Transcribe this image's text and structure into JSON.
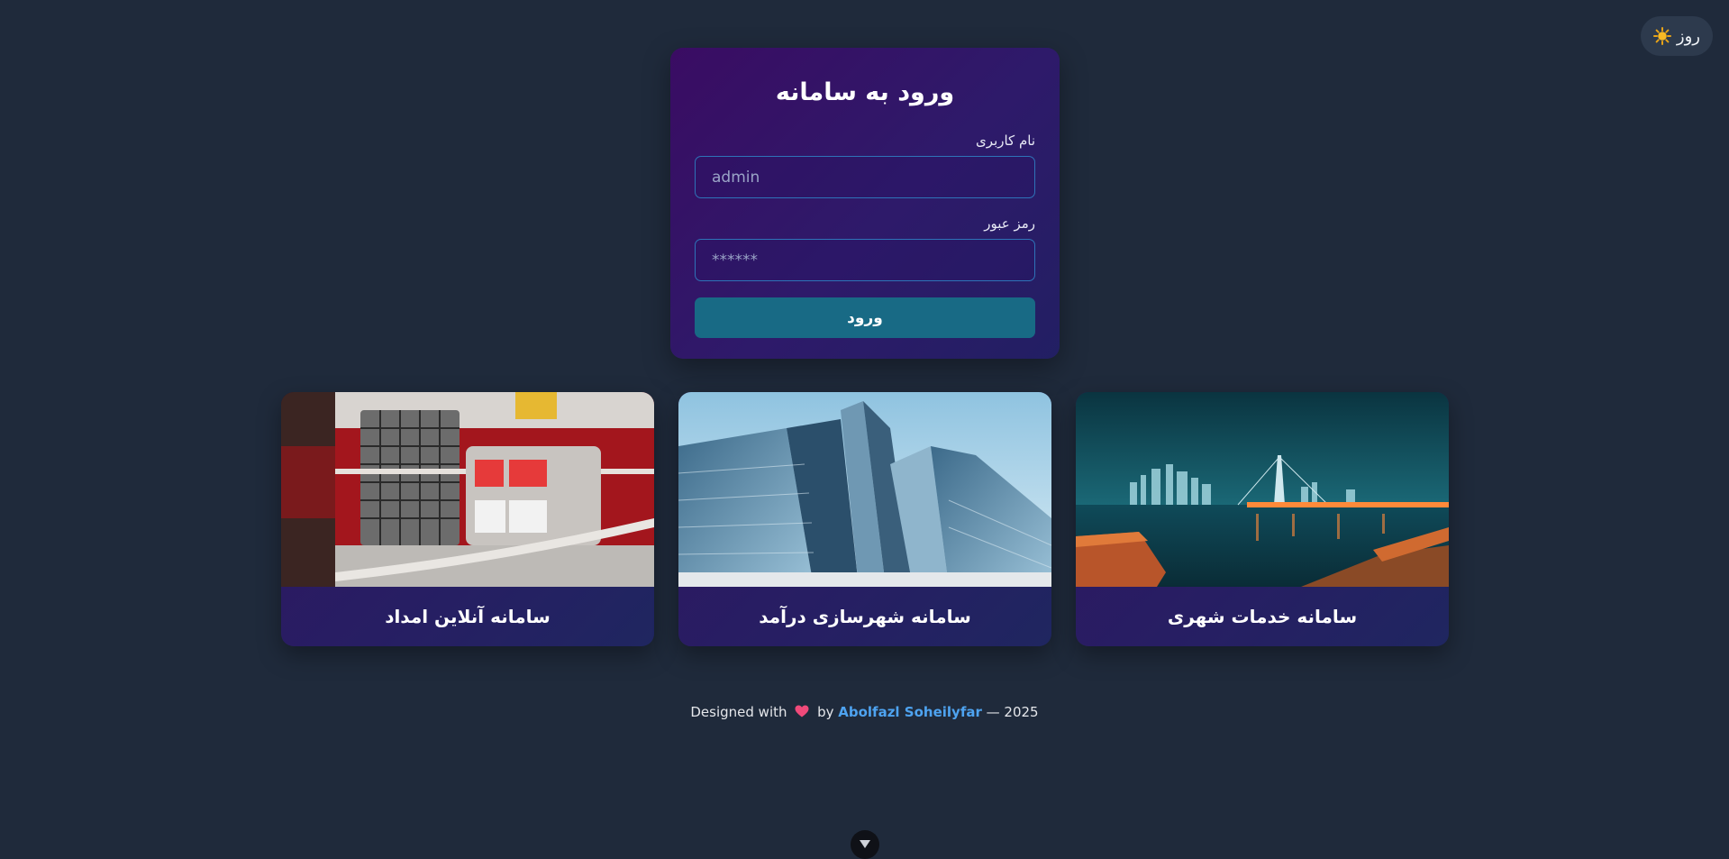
{
  "theme_toggle": {
    "label": "روز",
    "icon": "sun-icon"
  },
  "login": {
    "title": "ورود به سامانه",
    "username_label": "نام کاربری",
    "username_placeholder": "admin",
    "password_label": "رمز عبور",
    "password_placeholder": "******",
    "submit_label": "ورود"
  },
  "cards": [
    {
      "title": "سامانه آنلاین امداد",
      "image": "fire-truck-photo"
    },
    {
      "title": "سامانه شهرسازی درآمد",
      "image": "skyscrapers-photo"
    },
    {
      "title": "سامانه خدمات شهری",
      "image": "city-night-bridge-photo"
    }
  ],
  "footer": {
    "prefix": "Designed with",
    "by": "by",
    "author": "Abolfazl Soheilyfar",
    "suffix": "— 2025"
  },
  "colors": {
    "background": "#1f2a3b",
    "accent_button": "#186a85",
    "link": "#4ea3f0"
  }
}
